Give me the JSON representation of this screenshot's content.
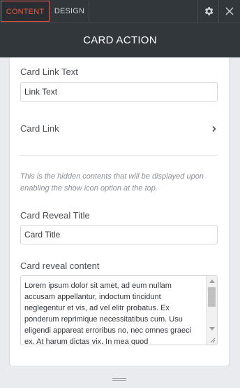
{
  "tabs": {
    "content": "CONTENT",
    "design": "DESIGN"
  },
  "header": {
    "title": "CARD ACTION"
  },
  "fields": {
    "card_link_text": {
      "label": "Card Link Text",
      "value": "Link Text"
    },
    "card_link": {
      "label": "Card Link"
    },
    "note": "This is the hidden contents that will be displayed upon enabling the show icon option at the top.",
    "card_reveal_title": {
      "label": "Card Reveal Title",
      "value": "Card Title"
    },
    "card_reveal_content": {
      "label": "Card reveal content",
      "value": "Lorem ipsum dolor sit amet, ad eum nullam accusam appellantur, indoctum tincidunt neglegentur et vis, ad vel elitr probatus. Ex ponderum reprimique necessitatibus cum. Usu eligendi appareat erroribus no, nec omnes graeci ex. At harum dictas vix. In mea quod"
    }
  },
  "colors": {
    "accent": "#e9573f",
    "topbar": "#32373c",
    "panel": "#ffffff"
  },
  "icons": {
    "settings": "gear-icon",
    "close": "close-icon",
    "card_link": "chevron-right-icon"
  }
}
